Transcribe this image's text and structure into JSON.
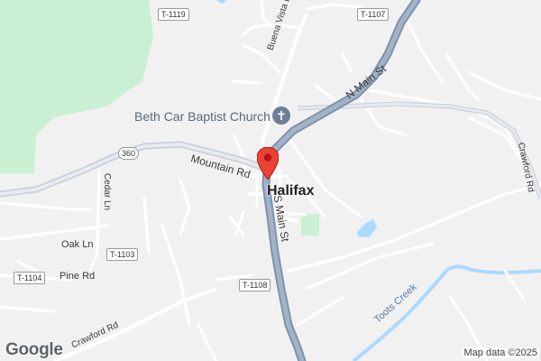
{
  "colors": {
    "background": "#f2f1f1",
    "park": "#c9f0d3",
    "water": "#aadaff",
    "highway": "#8ea4bd",
    "road": "#ffffff",
    "pin": "#ea4335"
  },
  "roads": {
    "s_main_st": "S Main St",
    "n_main_st": "N Main St",
    "mountain_rd": "Mountain Rd",
    "buena_vista_dr": "Buena Vista Dr",
    "cedar_ln": "Cedar Ln",
    "oak_ln": "Oak Ln",
    "pine_rd": "Pine Rd",
    "crawford_rd_sw": "Crawford Rd",
    "crawford_rd_e": "Crawford Rd"
  },
  "shields": {
    "t1119": "T-1119",
    "t1107": "T-1107",
    "r360": "360",
    "t1103": "T-1103",
    "t1104": "T-1104",
    "t1108": "T-1108"
  },
  "places": {
    "halifax": "Halifax",
    "church": "Beth Car Baptist Church"
  },
  "water": {
    "toots_creek": "Toots Creek"
  },
  "icons": {
    "church_icon": "cross",
    "pin_icon": "map-marker"
  },
  "footer": {
    "logo": "Google",
    "attribution": "Map data ©2025"
  }
}
